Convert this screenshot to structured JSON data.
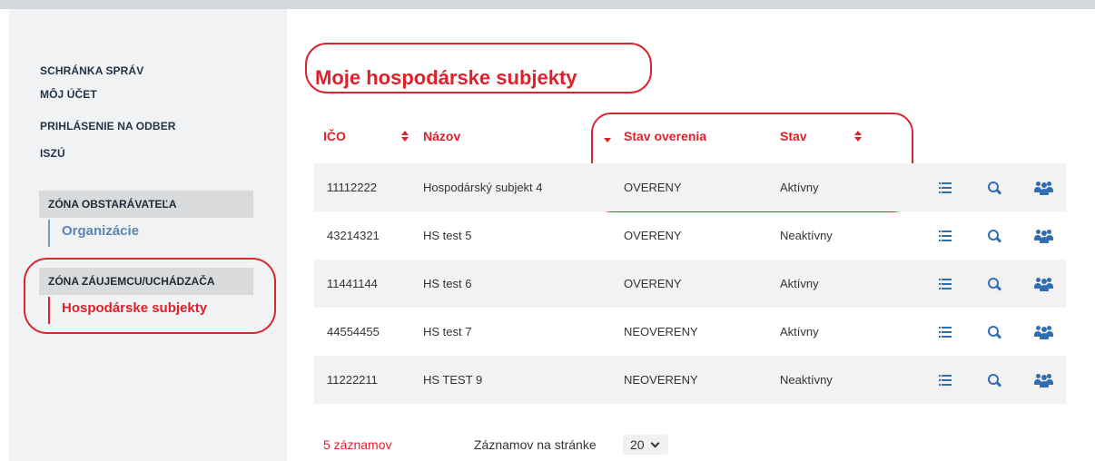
{
  "sidebar": {
    "links": [
      "SCHRÁNKA SPRÁV",
      "MÔJ ÚČET",
      "PRIHLÁSENIE NA ODBER",
      "ISZÚ"
    ],
    "zones": [
      {
        "header": "ZÓNA OBSTARÁVATEĽA",
        "item": "Organizácie"
      },
      {
        "header": "ZÓNA ZÁUJEMCU/UCHÁDZAČA",
        "item": "Hospodárske subjekty"
      }
    ]
  },
  "main": {
    "title": "Moje hospodárske subjekty",
    "columns": [
      "IČO",
      "Názov",
      "Stav overenia",
      "Stav"
    ],
    "rows": [
      {
        "ico": "11112222",
        "nazov": "Hospodárský subjekt 4",
        "overenie": "OVERENY",
        "stav": "Aktívny"
      },
      {
        "ico": "43214321",
        "nazov": "HS test 5",
        "overenie": "OVERENY",
        "stav": "Neaktívny"
      },
      {
        "ico": "11441144",
        "nazov": "HS test 6",
        "overenie": "OVERENY",
        "stav": "Aktívny"
      },
      {
        "ico": "44554455",
        "nazov": "HS test 7",
        "overenie": "NEOVERENY",
        "stav": "Aktívny"
      },
      {
        "ico": "11222211",
        "nazov": "HS TEST 9",
        "overenie": "NEOVERENY",
        "stav": "Neaktívny"
      }
    ],
    "row_icons": [
      "list-icon",
      "search-icon",
      "users-icon"
    ],
    "footer": {
      "count": "5 záznamov",
      "per_page_label": "Záznamov na stránke",
      "per_page_value": "20"
    }
  },
  "colors": {
    "accent": "#e0202a",
    "icon": "#2f6db5",
    "org_link": "#5a85b5"
  }
}
